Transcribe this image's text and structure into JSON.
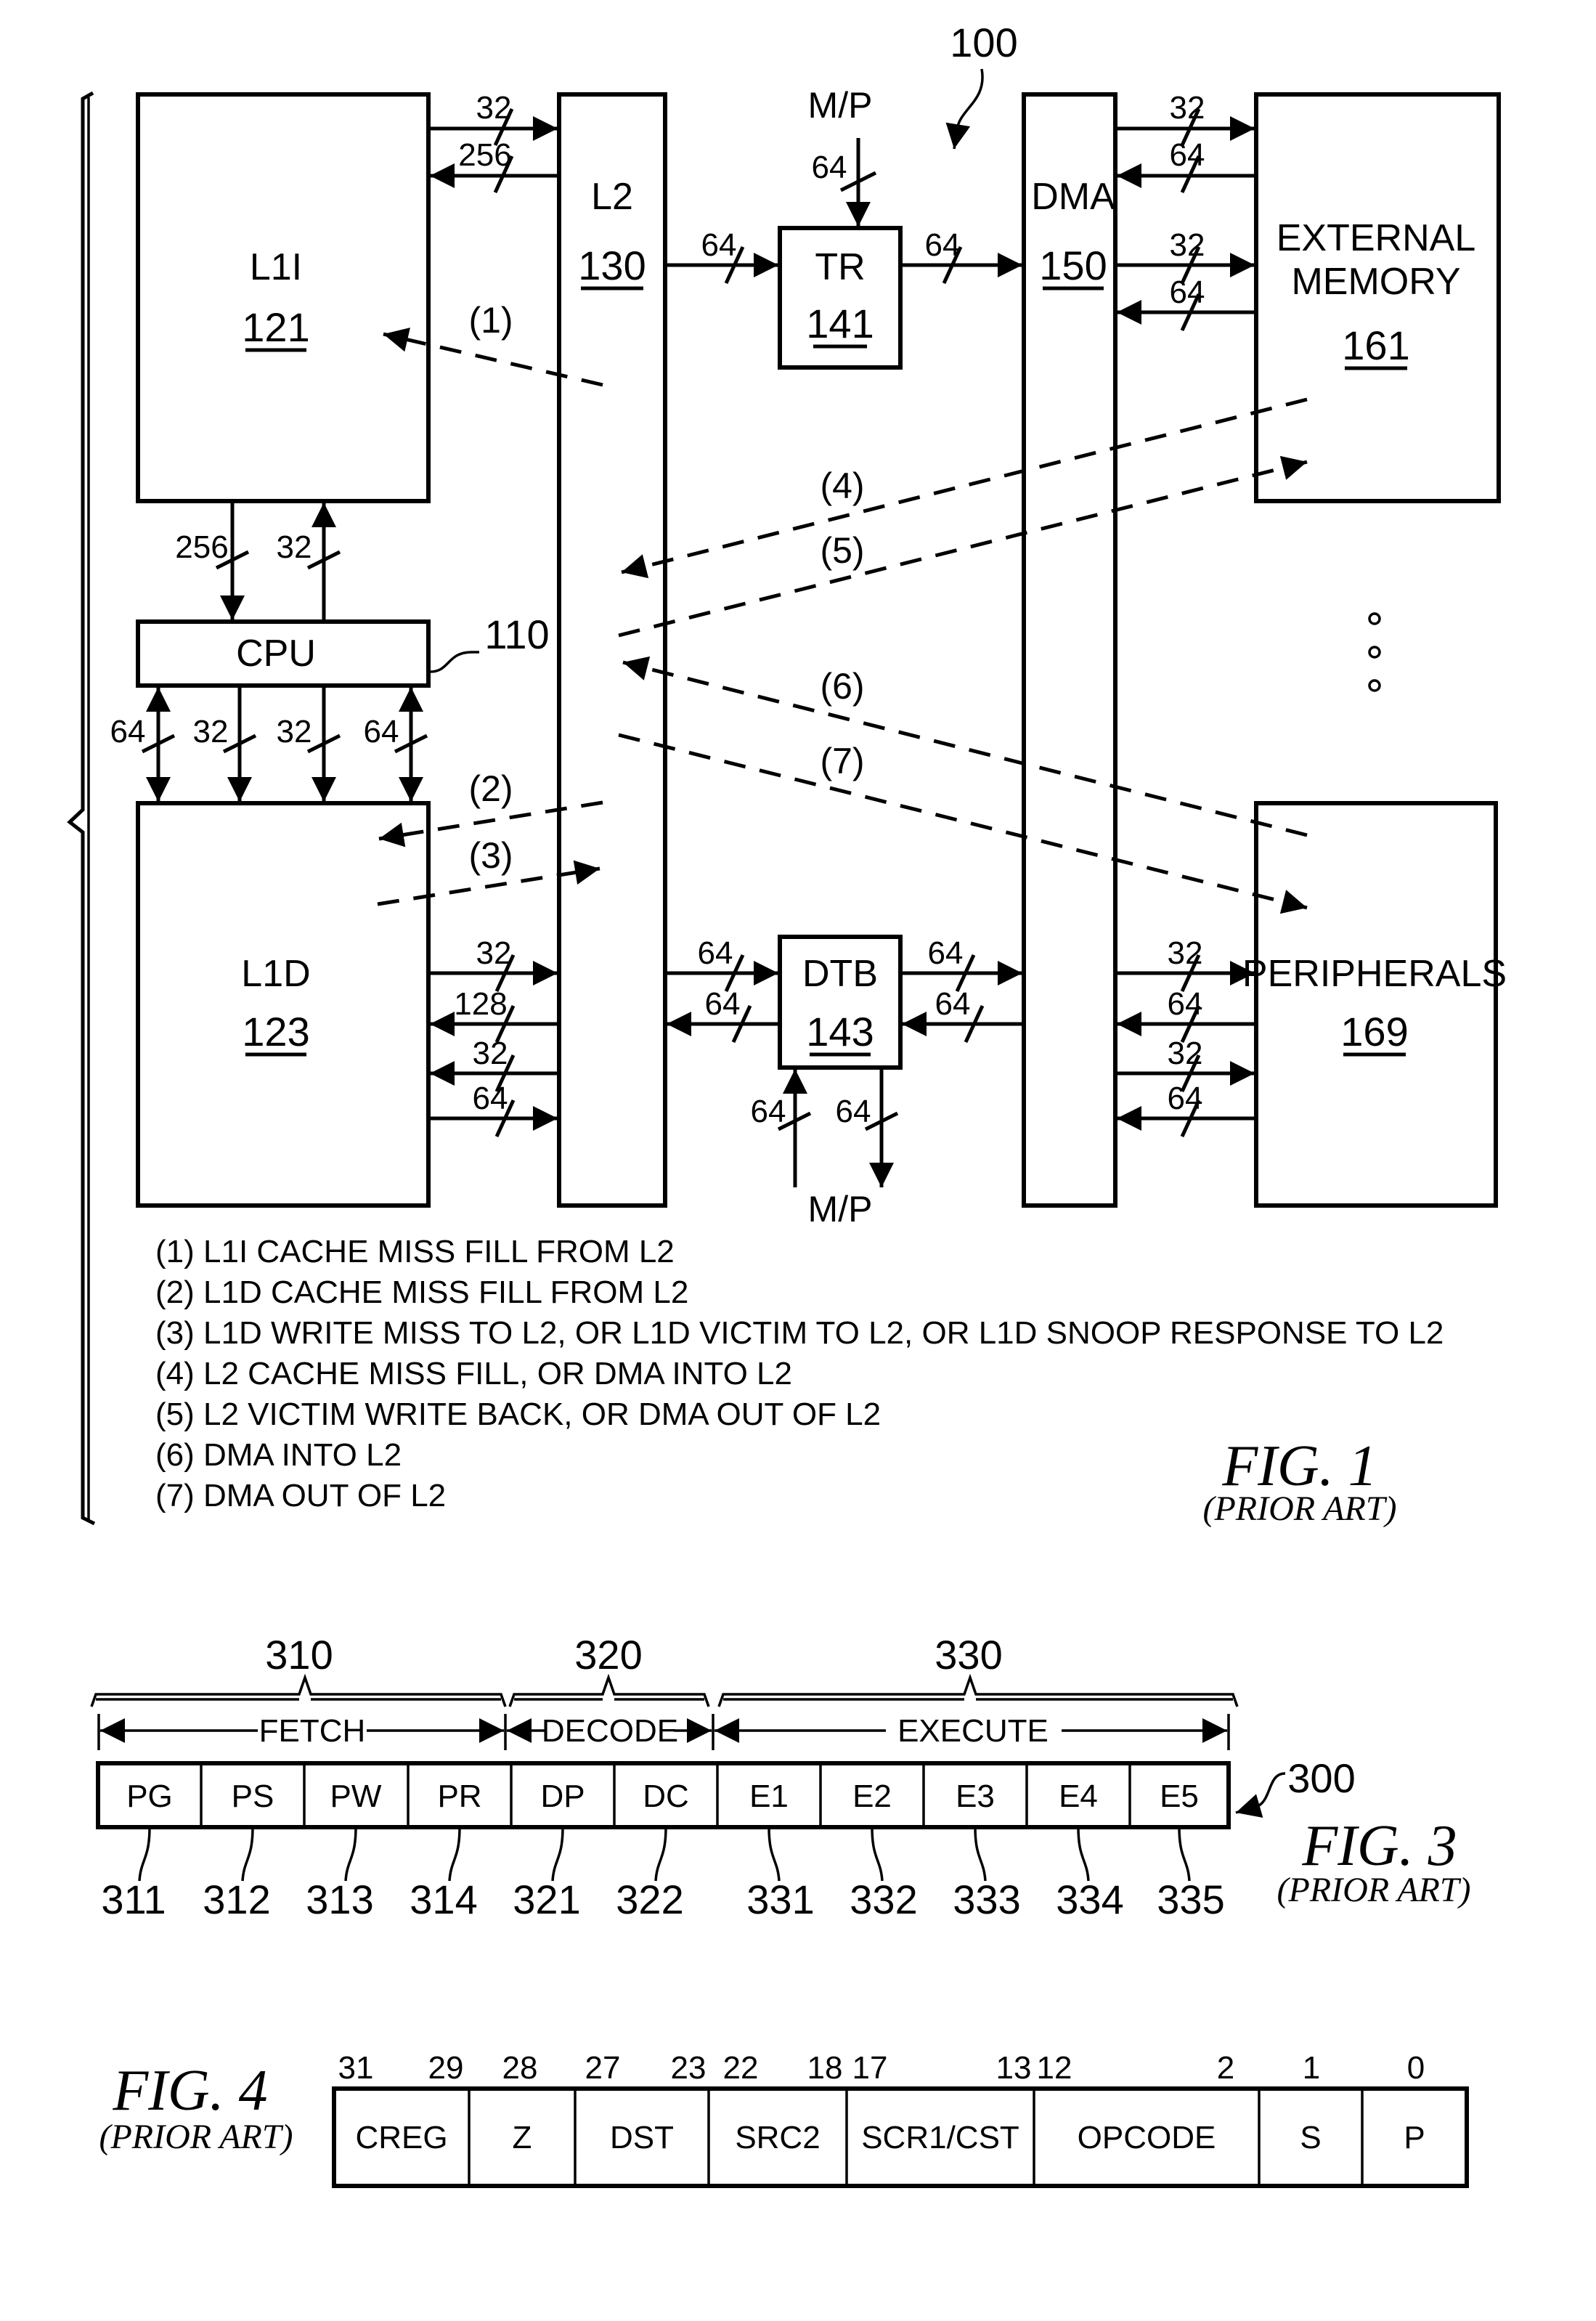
{
  "fig1": {
    "ref_label": "100",
    "blocks": {
      "l1i": {
        "name": "L1I",
        "ref": "121"
      },
      "l2": {
        "name": "L2",
        "ref": "130"
      },
      "tr": {
        "name": "TR",
        "ref": "141"
      },
      "dma": {
        "name": "DMA",
        "ref": "150"
      },
      "ext_mem": {
        "name_line1": "EXTERNAL",
        "name_line2": "MEMORY",
        "ref": "161"
      },
      "cpu": {
        "name": "CPU",
        "ref": "110"
      },
      "l1d": {
        "name": "L1D",
        "ref": "123"
      },
      "dtb": {
        "name": "DTB",
        "ref": "143"
      },
      "peripherals": {
        "name": "PERIPHERALS",
        "ref": "169"
      }
    },
    "mp_top": "M/P",
    "mp_bottom": "M/P",
    "bus_widths": {
      "l1i_to_l2": "32",
      "l2_to_l1i": "256",
      "l2_to_tr": "64",
      "mp_to_tr": "64",
      "tr_to_dma": "64",
      "dma_to_ext_1": "32",
      "ext_to_dma_1": "64",
      "dma_to_ext_2": "32",
      "ext_to_dma_2": "64",
      "l1i_to_cpu": "256",
      "cpu_to_l1i": "32",
      "cpu_l1d_a": "64",
      "cpu_l1d_b": "32",
      "cpu_l1d_c": "32",
      "cpu_l1d_d": "64",
      "l1d_to_l2_1": "32",
      "l2_to_l1d_1": "128",
      "l2_to_l1d_2": "32",
      "l1d_to_l2_2": "64",
      "l2_to_dtb": "64",
      "dtb_to_l2": "64",
      "dtb_to_dma": "64",
      "dma_to_dtb": "64",
      "mp_to_dtb": "64",
      "dtb_to_mp": "64",
      "dma_to_per_1": "32",
      "per_to_dma_1": "64",
      "dma_to_per_2": "32",
      "per_to_dma_2": "64"
    },
    "paths": [
      "(1)",
      "(2)",
      "(3)",
      "(4)",
      "(5)",
      "(6)",
      "(7)"
    ],
    "legend": [
      "(1) L1I CACHE MISS FILL FROM L2",
      "(2) L1D CACHE MISS FILL FROM L2",
      "(3) L1D WRITE MISS TO L2, OR L1D VICTIM TO L2, OR L1D SNOOP RESPONSE TO L2",
      "(4) L2 CACHE MISS FILL, OR DMA INTO L2",
      "(5) L2 VICTIM WRITE BACK, OR DMA OUT OF L2",
      "(6) DMA INTO L2",
      "(7) DMA OUT OF L2"
    ],
    "title": "FIG. 1",
    "subtitle": "(PRIOR ART)"
  },
  "fig3": {
    "ref_label": "300",
    "groups": [
      {
        "ref": "310",
        "name": "FETCH"
      },
      {
        "ref": "320",
        "name": "DECODE"
      },
      {
        "ref": "330",
        "name": "EXECUTE"
      }
    ],
    "stages": [
      {
        "name": "PG",
        "ref": "311"
      },
      {
        "name": "PS",
        "ref": "312"
      },
      {
        "name": "PW",
        "ref": "313"
      },
      {
        "name": "PR",
        "ref": "314"
      },
      {
        "name": "DP",
        "ref": "321"
      },
      {
        "name": "DC",
        "ref": "322"
      },
      {
        "name": "E1",
        "ref": "331"
      },
      {
        "name": "E2",
        "ref": "332"
      },
      {
        "name": "E3",
        "ref": "333"
      },
      {
        "name": "E4",
        "ref": "334"
      },
      {
        "name": "E5",
        "ref": "335"
      }
    ],
    "title": "FIG. 3",
    "subtitle": "(PRIOR ART)"
  },
  "fig4": {
    "fields": [
      {
        "name": "CREG",
        "bits_hi": "31",
        "bits_lo": "29"
      },
      {
        "name": "Z",
        "bits_hi": "28",
        "bits_lo": ""
      },
      {
        "name": "DST",
        "bits_hi": "27",
        "bits_lo": "23"
      },
      {
        "name": "SRC2",
        "bits_hi": "22",
        "bits_lo": "18"
      },
      {
        "name": "SCR1/CST",
        "bits_hi": "17",
        "bits_lo": "13"
      },
      {
        "name": "OPCODE",
        "bits_hi": "12",
        "bits_lo": "2"
      },
      {
        "name": "S",
        "bits_hi": "1",
        "bits_lo": ""
      },
      {
        "name": "P",
        "bits_hi": "0",
        "bits_lo": ""
      }
    ],
    "title": "FIG. 4",
    "subtitle": "(PRIOR ART)"
  }
}
